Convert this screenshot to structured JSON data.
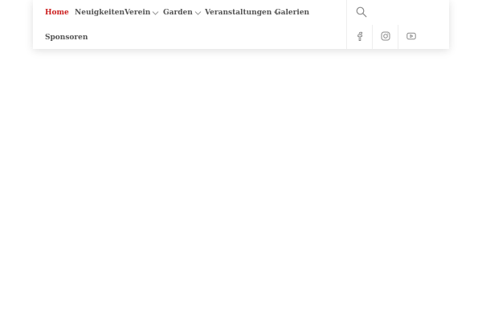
{
  "nav": {
    "items": [
      {
        "label": "Home",
        "active": true,
        "dropdown": false
      },
      {
        "label": "Neuigkeiten",
        "active": false,
        "dropdown": false
      },
      {
        "label": "Verein",
        "active": false,
        "dropdown": true
      },
      {
        "label": "Garden",
        "active": false,
        "dropdown": true
      },
      {
        "label": "Veranstaltungen",
        "active": false,
        "dropdown": true
      },
      {
        "label": "Galerien",
        "active": false,
        "dropdown": false
      },
      {
        "label": "Sponsoren",
        "active": false,
        "dropdown": false
      }
    ]
  },
  "actions": {
    "search_icon": "search-icon",
    "social": [
      {
        "network": "facebook",
        "icon": "facebook-icon"
      },
      {
        "network": "instagram",
        "icon": "instagram-icon"
      },
      {
        "network": "youtube",
        "icon": "youtube-icon"
      }
    ]
  },
  "colors": {
    "active_nav": "#cc1f1f",
    "nav_text": "#555555",
    "icon": "#888888",
    "divider": "#eeeeee"
  }
}
